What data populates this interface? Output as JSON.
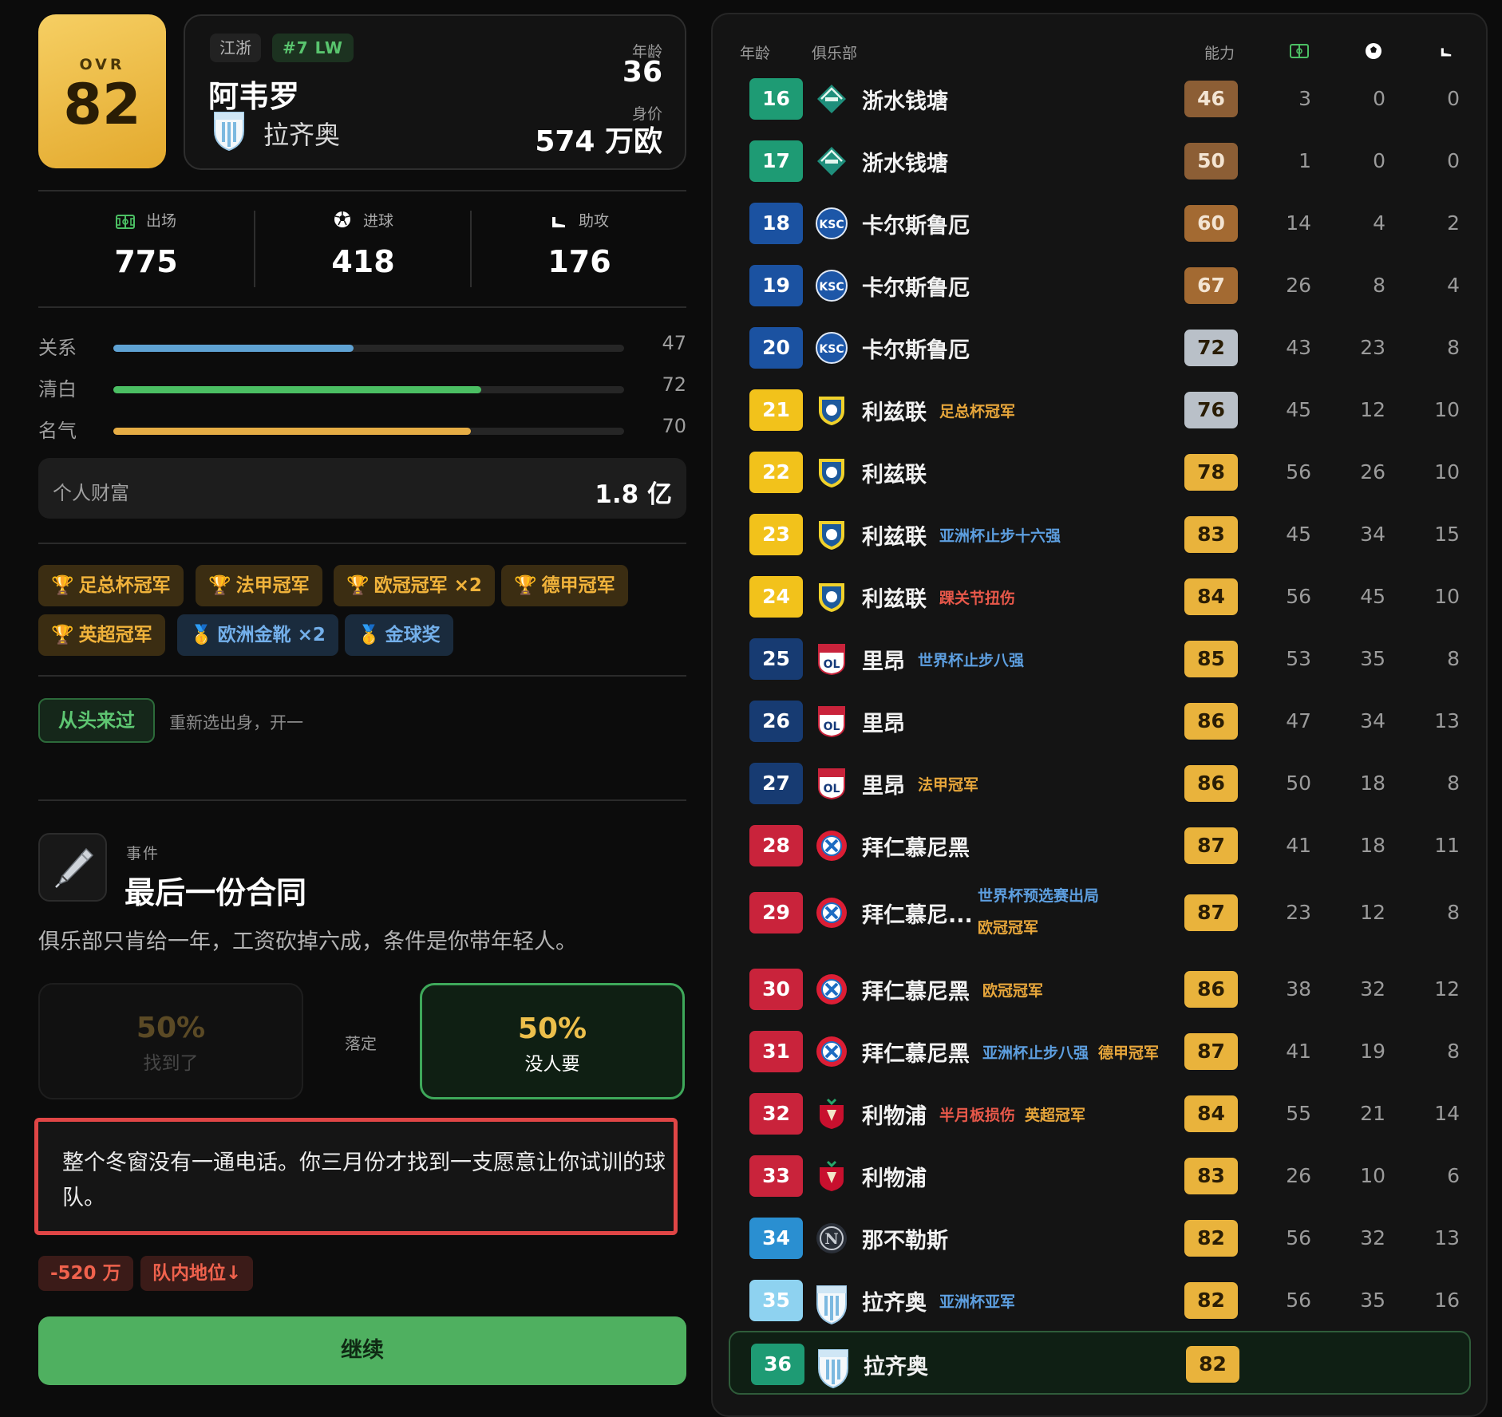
{
  "player": {
    "ovr_label": "OVR",
    "ovr": "82",
    "region": "江浙",
    "position": "#7 LW",
    "name": "阿韦罗",
    "club": "拉齐奥",
    "age_label": "年龄",
    "age": "36",
    "value_label": "身价",
    "value": "574 万欧"
  },
  "career": {
    "apps_label": "出场",
    "apps": "775",
    "goals_label": "进球",
    "goals": "418",
    "assists_label": "助攻",
    "assists": "176"
  },
  "attributes": [
    {
      "label": "关系",
      "value": "47",
      "fill": 0.47,
      "color": "#5fa2d3"
    },
    {
      "label": "清白",
      "value": "72",
      "fill": 0.72,
      "color": "#4bbf63"
    },
    {
      "label": "名气",
      "value": "70",
      "fill": 0.7,
      "color": "#e6ad45"
    }
  ],
  "wealth": {
    "label": "个人财富",
    "value": "1.8 亿"
  },
  "honors": [
    {
      "label": "足总杯冠军",
      "kind": "trophy"
    },
    {
      "label": "法甲冠军",
      "kind": "trophy"
    },
    {
      "label": "欧冠冠军 ×2",
      "kind": "trophy"
    },
    {
      "label": "德甲冠军",
      "kind": "trophy"
    },
    {
      "label": "英超冠军",
      "kind": "trophy"
    },
    {
      "label": "欧洲金靴 ×2",
      "kind": "medal"
    },
    {
      "label": "金球奖",
      "kind": "medal"
    }
  ],
  "restart": {
    "button": "从头来过",
    "desc": "重新选出身，开一"
  },
  "event": {
    "label": "事件",
    "title": "最后一份合同",
    "desc": "俱乐部只肯给一年，工资砍掉六成，条件是你带年轻人。",
    "option_a": {
      "pct": "50%",
      "label": "找到了"
    },
    "settle": "落定",
    "option_b": {
      "pct": "50%",
      "label": "没人要"
    },
    "result": "整个冬窗没有一通电话。你三月份才找到一支愿意让你试训的球队。",
    "effects": [
      "-520 万",
      "队内地位↓"
    ],
    "continue": "继续"
  },
  "history_headers": {
    "age": "年龄",
    "club": "俱乐部",
    "ability": "能力"
  },
  "colors": {
    "teal": "#1e9b74",
    "blue": "#1b52a1",
    "yellow": "#f2c21b",
    "navy": "#173b72",
    "red": "#c9233b",
    "sky": "#2a8fd1",
    "light": "#8ed2f0",
    "ovr_brown": "#8c5e35",
    "ovr_copper": "#a36a32",
    "ovr_silver": "#b9c0c8",
    "ovr_gold": "#e9b33c"
  },
  "history": [
    {
      "age": "16",
      "club": "浙水钱塘",
      "badge": "zhe",
      "ovr": "46",
      "apps": "3",
      "goals": "0",
      "assists": "0",
      "age_color": "teal",
      "ovr_color": "ovr_brown",
      "notes": []
    },
    {
      "age": "17",
      "club": "浙水钱塘",
      "badge": "zhe",
      "ovr": "50",
      "apps": "1",
      "goals": "0",
      "assists": "0",
      "age_color": "teal",
      "ovr_color": "ovr_brown",
      "notes": []
    },
    {
      "age": "18",
      "club": "卡尔斯鲁厄",
      "badge": "ksc",
      "ovr": "60",
      "apps": "14",
      "goals": "4",
      "assists": "2",
      "age_color": "blue",
      "ovr_color": "ovr_copper",
      "notes": []
    },
    {
      "age": "19",
      "club": "卡尔斯鲁厄",
      "badge": "ksc",
      "ovr": "67",
      "apps": "26",
      "goals": "8",
      "assists": "4",
      "age_color": "blue",
      "ovr_color": "ovr_copper",
      "notes": []
    },
    {
      "age": "20",
      "club": "卡尔斯鲁厄",
      "badge": "ksc",
      "ovr": "72",
      "apps": "43",
      "goals": "23",
      "assists": "8",
      "age_color": "blue",
      "ovr_color": "ovr_silver",
      "notes": []
    },
    {
      "age": "21",
      "club": "利兹联",
      "badge": "leeds",
      "ovr": "76",
      "apps": "45",
      "goals": "12",
      "assists": "10",
      "age_color": "yellow",
      "ovr_color": "ovr_silver",
      "notes": [
        {
          "text": "足总杯冠军",
          "color": "#e7a63b"
        }
      ]
    },
    {
      "age": "22",
      "club": "利兹联",
      "badge": "leeds",
      "ovr": "78",
      "apps": "56",
      "goals": "26",
      "assists": "10",
      "age_color": "yellow",
      "ovr_color": "ovr_gold",
      "notes": []
    },
    {
      "age": "23",
      "club": "利兹联",
      "badge": "leeds",
      "ovr": "83",
      "apps": "45",
      "goals": "34",
      "assists": "15",
      "age_color": "yellow",
      "ovr_color": "ovr_gold",
      "notes": [
        {
          "text": "亚洲杯止步十六强",
          "color": "#5d9fe0"
        }
      ]
    },
    {
      "age": "24",
      "club": "利兹联",
      "badge": "leeds",
      "ovr": "84",
      "apps": "56",
      "goals": "45",
      "assists": "10",
      "age_color": "yellow",
      "ovr_color": "ovr_gold",
      "notes": [
        {
          "text": "踝关节扭伤",
          "color": "#e8584a"
        }
      ]
    },
    {
      "age": "25",
      "club": "里昂",
      "badge": "ol",
      "ovr": "85",
      "apps": "53",
      "goals": "35",
      "assists": "8",
      "age_color": "navy",
      "ovr_color": "ovr_gold",
      "notes": [
        {
          "text": "世界杯止步八强",
          "color": "#5d9fe0"
        }
      ]
    },
    {
      "age": "26",
      "club": "里昂",
      "badge": "ol",
      "ovr": "86",
      "apps": "47",
      "goals": "34",
      "assists": "13",
      "age_color": "navy",
      "ovr_color": "ovr_gold",
      "notes": []
    },
    {
      "age": "27",
      "club": "里昂",
      "badge": "ol",
      "ovr": "86",
      "apps": "50",
      "goals": "18",
      "assists": "8",
      "age_color": "navy",
      "ovr_color": "ovr_gold",
      "notes": [
        {
          "text": "法甲冠军",
          "color": "#e7a63b"
        }
      ]
    },
    {
      "age": "28",
      "club": "拜仁慕尼黑",
      "badge": "fcb",
      "ovr": "87",
      "apps": "41",
      "goals": "18",
      "assists": "11",
      "age_color": "red",
      "ovr_color": "ovr_gold",
      "notes": []
    },
    {
      "age": "29",
      "club": "拜仁慕尼...",
      "badge": "fcb",
      "ovr": "87",
      "apps": "23",
      "goals": "12",
      "assists": "8",
      "age_color": "red",
      "ovr_color": "ovr_gold",
      "notes": [
        {
          "text": "世界杯预选赛出局",
          "color": "#5d9fe0"
        },
        {
          "text": "欧冠冠军",
          "color": "#e7a63b"
        }
      ]
    },
    {
      "age": "30",
      "club": "拜仁慕尼黑",
      "badge": "fcb",
      "ovr": "86",
      "apps": "38",
      "goals": "32",
      "assists": "12",
      "age_color": "red",
      "ovr_color": "ovr_gold",
      "notes": [
        {
          "text": "欧冠冠军",
          "color": "#e7a63b"
        }
      ]
    },
    {
      "age": "31",
      "club": "拜仁慕尼黑",
      "badge": "fcb",
      "ovr": "87",
      "apps": "41",
      "goals": "19",
      "assists": "8",
      "age_color": "red",
      "ovr_color": "ovr_gold",
      "notes": [
        {
          "text": "亚洲杯止步八强",
          "color": "#5d9fe0"
        },
        {
          "text": "德甲冠军",
          "color": "#e7a63b"
        }
      ]
    },
    {
      "age": "32",
      "club": "利物浦",
      "badge": "lfc",
      "ovr": "84",
      "apps": "55",
      "goals": "21",
      "assists": "14",
      "age_color": "red",
      "ovr_color": "ovr_gold",
      "notes": [
        {
          "text": "半月板损伤",
          "color": "#e8584a"
        },
        {
          "text": "英超冠军",
          "color": "#e7a63b"
        }
      ]
    },
    {
      "age": "33",
      "club": "利物浦",
      "badge": "lfc",
      "ovr": "83",
      "apps": "26",
      "goals": "10",
      "assists": "6",
      "age_color": "red",
      "ovr_color": "ovr_gold",
      "notes": []
    },
    {
      "age": "34",
      "club": "那不勒斯",
      "badge": "nap",
      "ovr": "82",
      "apps": "56",
      "goals": "32",
      "assists": "13",
      "age_color": "sky",
      "ovr_color": "ovr_gold",
      "notes": []
    },
    {
      "age": "35",
      "club": "拉齐奥",
      "badge": "laz",
      "ovr": "82",
      "apps": "56",
      "goals": "35",
      "assists": "16",
      "age_color": "light",
      "ovr_color": "ovr_gold",
      "notes": [
        {
          "text": "亚洲杯亚军",
          "color": "#5d9fe0"
        }
      ]
    },
    {
      "age": "36",
      "club": "拉齐奥",
      "badge": "laz",
      "ovr": "82",
      "apps": "",
      "goals": "",
      "assists": "",
      "age_color": "teal",
      "ovr_color": "ovr_gold",
      "notes": [],
      "current": true
    }
  ]
}
